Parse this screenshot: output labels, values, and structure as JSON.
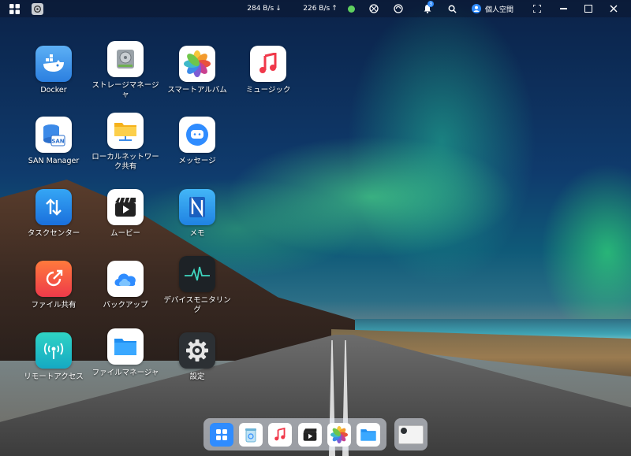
{
  "topbar": {
    "download_speed": "284 B/s",
    "upload_speed": "226 B/s",
    "notification_count": "3",
    "user_label": "個人空間"
  },
  "apps": [
    {
      "label": "Docker",
      "icon": "docker-icon"
    },
    {
      "label": "ストレージマネージャ",
      "icon": "storage-manager-icon"
    },
    {
      "label": "スマートアルバム",
      "icon": "smart-album-icon"
    },
    {
      "label": "ミュージック",
      "icon": "music-icon"
    },
    {
      "label": "SAN Manager",
      "icon": "san-manager-icon"
    },
    {
      "label": "ローカルネットワーク共有",
      "icon": "local-network-share-icon"
    },
    {
      "label": "メッセージ",
      "icon": "message-icon"
    },
    {
      "label": "タスクセンター",
      "icon": "task-center-icon"
    },
    {
      "label": "ムービー",
      "icon": "movie-icon"
    },
    {
      "label": "メモ",
      "icon": "memo-icon"
    },
    {
      "label": "ファイル共有",
      "icon": "file-share-icon"
    },
    {
      "label": "バックアップ",
      "icon": "backup-icon"
    },
    {
      "label": "デバイスモニタリング",
      "icon": "device-monitoring-icon"
    },
    {
      "label": "リモートアクセス",
      "icon": "remote-access-icon"
    },
    {
      "label": "ファイルマネージャ",
      "icon": "file-manager-icon"
    },
    {
      "label": "設定",
      "icon": "settings-icon"
    }
  ],
  "dock": [
    "app-center-icon",
    "recycle-bin-icon",
    "music-icon",
    "movie-icon",
    "smart-album-icon",
    "file-manager-icon"
  ],
  "san_badge": "SAN",
  "colors": {
    "accent": "#2f8cff",
    "status_green": "#5fd05f"
  }
}
